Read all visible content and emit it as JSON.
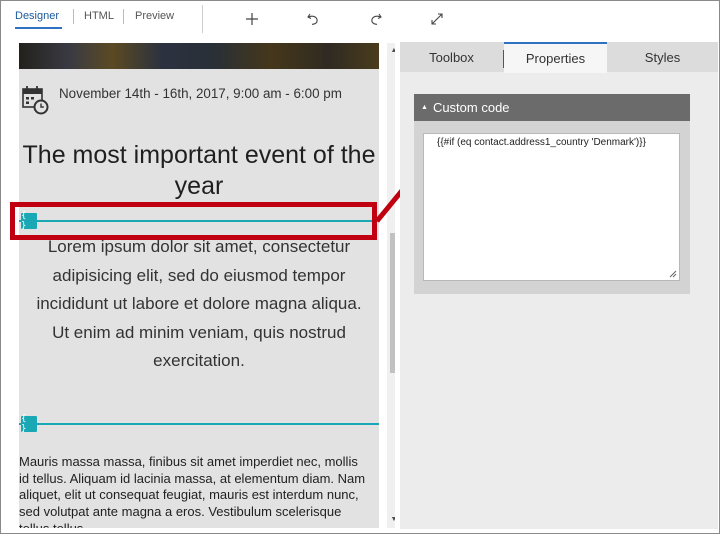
{
  "toolbar": {
    "tabs": [
      "Designer",
      "HTML",
      "Preview"
    ],
    "active_tab": "Designer",
    "tools": [
      "add-icon",
      "undo-icon",
      "redo-icon",
      "expand-icon"
    ]
  },
  "email": {
    "event_date": "November 14th - 16th, 2017, 9:00 am - 6:00 pm",
    "title": "The most important event of the year",
    "lorem": "Lorem ipsum dolor sit amet, consectetur adipisicing elit, sed do eiusmod tempor incididunt ut labore et dolore magna aliqua. Ut enim ad minim veniam, quis nostrud exercitation.",
    "mauris": "Mauris massa massa, finibus sit amet imperdiet nec, mollis id tellus. Aliquam id lacinia massa, at elementum diam. Nam aliquet, elit ut consequat feugiat, mauris est interdum nunc, sed volutpat ante magna a eros. Vestibulum scelerisque tellus tellus,",
    "code_tag_symbol": "{ }"
  },
  "panel": {
    "tabs": [
      "Toolbox",
      "Properties",
      "Styles"
    ],
    "active_tab": "Properties",
    "section_title": "Custom code",
    "code_value": "{{#if (eq contact.address1_country 'Denmark')}}"
  },
  "colors": {
    "accent_blue": "#2e72c2",
    "callout_red": "#c00010",
    "teal": "#19a8b4",
    "section_header": "#6b6b6b"
  }
}
